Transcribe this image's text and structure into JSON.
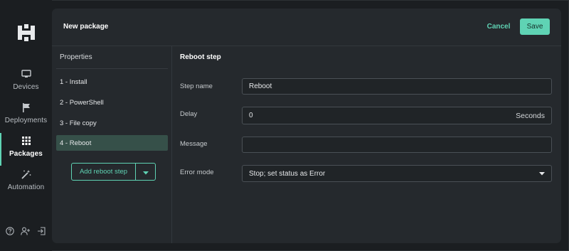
{
  "sidebar": {
    "items": [
      {
        "label": "Devices",
        "icon": "monitor-icon"
      },
      {
        "label": "Deployments",
        "icon": "flag-icon"
      },
      {
        "label": "Packages",
        "icon": "grid-icon",
        "active": true
      },
      {
        "label": "Automation",
        "icon": "magic-wand-icon"
      }
    ],
    "bottom_icons": [
      "help-icon",
      "add-user-icon",
      "logout-icon"
    ]
  },
  "header": {
    "title": "New package",
    "cancel_label": "Cancel",
    "save_label": "Save"
  },
  "properties": {
    "title": "Properties",
    "steps": [
      "1 - Install",
      "2 - PowerShell",
      "3 - File copy",
      "4 - Reboot"
    ],
    "selected_index": 3,
    "add_button_label": "Add reboot step"
  },
  "step_form": {
    "title": "Reboot step",
    "step_name_label": "Step name",
    "step_name_value": "Reboot",
    "delay_label": "Delay",
    "delay_value": "0",
    "delay_unit": "Seconds",
    "message_label": "Message",
    "message_value": "",
    "error_mode_label": "Error mode",
    "error_mode_value": "Stop; set status as Error"
  },
  "colors": {
    "accent": "#5fd3b4",
    "background": "#1b1e21",
    "card": "#25292d",
    "selected": "#365049"
  }
}
